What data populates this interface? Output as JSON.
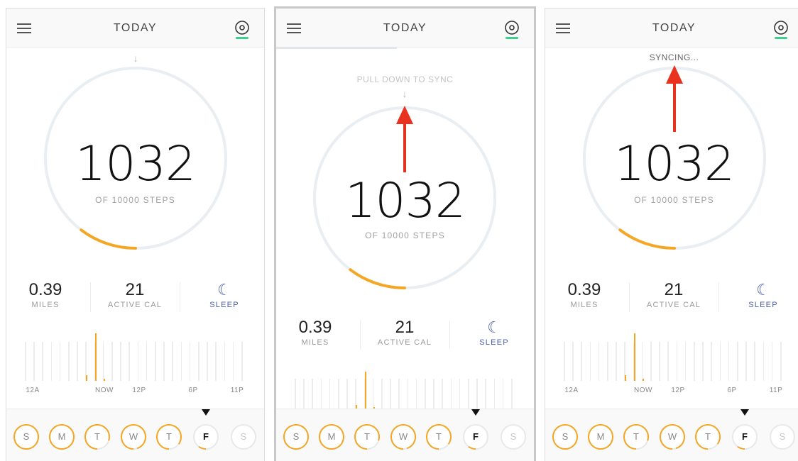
{
  "screens": [
    {
      "title": "TODAY",
      "hint": "",
      "steps": "1032",
      "steps_label": "OF 10000 STEPS",
      "miles_value": "0.39",
      "miles_label": "MILES",
      "cal_value": "21",
      "cal_label": "ACTIVE CAL",
      "sleep_label": "SLEEP",
      "hist_labels": [
        "12A",
        "NOW",
        "12P",
        "6P",
        "11P"
      ],
      "days": [
        "S",
        "M",
        "T",
        "W",
        "T",
        "F",
        "S"
      ]
    },
    {
      "title": "TODAY",
      "hint": "PULL DOWN TO SYNC",
      "steps": "1032",
      "steps_label": "OF 10000 STEPS",
      "miles_value": "0.39",
      "miles_label": "MILES",
      "cal_value": "21",
      "cal_label": "ACTIVE CAL",
      "sleep_label": "SLEEP",
      "hist_labels": [],
      "days": [
        "S",
        "M",
        "T",
        "W",
        "T",
        "F",
        "S"
      ]
    },
    {
      "title": "TODAY",
      "hint": "SYNCING...",
      "steps": "1032",
      "steps_label": "OF 10000 STEPS",
      "miles_value": "0.39",
      "miles_label": "MILES",
      "cal_value": "21",
      "cal_label": "ACTIVE CAL",
      "sleep_label": "SLEEP",
      "hist_labels": [
        "12A",
        "NOW",
        "12P",
        "6P",
        "11P"
      ],
      "days": [
        "S",
        "M",
        "T",
        "W",
        "T",
        "F",
        "S"
      ]
    }
  ],
  "progress": {
    "steps": 1032,
    "goal": 10000
  },
  "selected_day_index": 5,
  "day_progress": [
    1.0,
    1.0,
    0.8,
    0.95,
    0.85,
    0.1,
    0.0
  ],
  "colors": {
    "accent_orange": "#f5a623",
    "ring_track": "#e8eef1",
    "sleep_blue": "#4a5fa8",
    "annotation_red": "#e8321f",
    "device_green": "#3ecf8e"
  },
  "icons": {
    "menu": "menu-icon",
    "device": "device-icon",
    "sleep": "moon-icon",
    "pull": "arrow-down-icon"
  }
}
